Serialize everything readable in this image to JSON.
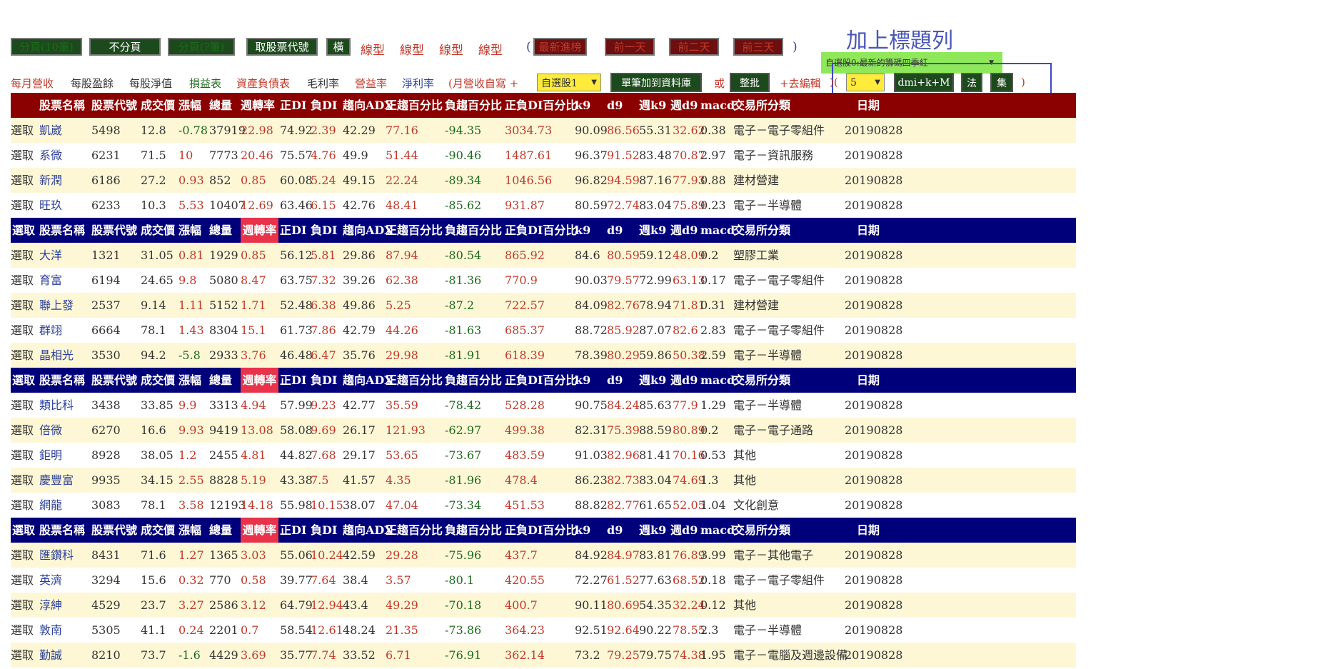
{
  "annotation": {
    "title": "加上標題列",
    "dropdown": "自選股0:最新的籌碼四季紅"
  },
  "top_buttons": [
    "分頁(10筆)",
    "不分頁",
    "分頁(?筆)",
    "取股票代號",
    "橫"
  ],
  "line_types": [
    "線型",
    "線型",
    "線型",
    "線型"
  ],
  "date_buttons": [
    "最新進榜",
    "前一天",
    "前二天",
    "前三天"
  ],
  "parens": {
    "open": "(",
    "close": ")"
  },
  "links": [
    "每月營收",
    "每股盈餘",
    "每股淨值",
    "損益表",
    "資產負債表",
    "毛利率",
    "營益率",
    "淨利率"
  ],
  "toolbar": {
    "monthly_custom": "(月營收自寫 +",
    "select_watchlist": "自選股1",
    "add_to_db": "單筆加到資料庫",
    "or": "或",
    "batch": "整批",
    "edit": "+去編輯",
    "paren_open": ")(",
    "count": "5",
    "dmi": "dmi+k+M",
    "fa": "法",
    "ji": "集",
    "close": ")"
  },
  "header": {
    "select": "選取",
    "cols": [
      "股票名稱",
      "股票代號",
      "成交價",
      "漲幅",
      "總量",
      "週轉率",
      "正DI",
      "負DI",
      "趨向ADX",
      "正趨百分比",
      "負趨百分比",
      "正負DI百分比",
      "k9",
      "d9",
      "週k9",
      "週d9",
      "macd",
      "交易所分類",
      "日期"
    ]
  },
  "rows": [
    {
      "type": "header",
      "style": "red"
    },
    {
      "type": "data",
      "v": [
        "選取",
        "凱崴",
        "5498",
        "12.8",
        "-0.78",
        "37919",
        "22.98",
        "74.92",
        "2.39",
        "42.29",
        "77.16",
        "-94.35",
        "3034.73",
        "90.09",
        "86.56",
        "55.31",
        "32.62",
        "0.38",
        "電子－電子零組件",
        "20190828"
      ]
    },
    {
      "type": "data",
      "v": [
        "選取",
        "系微",
        "6231",
        "71.5",
        "10",
        "7773",
        "20.46",
        "75.57",
        "4.76",
        "49.9",
        "51.44",
        "-90.46",
        "1487.61",
        "96.37",
        "91.52",
        "83.48",
        "70.87",
        "2.97",
        "電子－資訊服務",
        "20190828"
      ]
    },
    {
      "type": "data",
      "v": [
        "選取",
        "新潤",
        "6186",
        "27.2",
        "0.93",
        "852",
        "0.85",
        "60.08",
        "5.24",
        "49.15",
        "22.24",
        "-89.34",
        "1046.56",
        "96.82",
        "94.59",
        "87.16",
        "77.93",
        "0.88",
        "建材營建",
        "20190828"
      ]
    },
    {
      "type": "data",
      "v": [
        "選取",
        "旺玖",
        "6233",
        "10.3",
        "5.53",
        "10407",
        "12.69",
        "63.46",
        "6.15",
        "42.76",
        "48.41",
        "-85.62",
        "931.87",
        "80.59",
        "72.74",
        "83.04",
        "75.89",
        "0.23",
        "電子－半導體",
        "20190828"
      ]
    },
    {
      "type": "header",
      "style": "blue"
    },
    {
      "type": "data",
      "v": [
        "選取",
        "大洋",
        "1321",
        "31.05",
        "0.81",
        "1929",
        "0.85",
        "56.12",
        "5.81",
        "29.86",
        "87.94",
        "-80.54",
        "865.92",
        "84.6",
        "80.59",
        "59.12",
        "48.09",
        "0.2",
        "塑膠工業",
        "20190828"
      ]
    },
    {
      "type": "data",
      "v": [
        "選取",
        "育富",
        "6194",
        "24.65",
        "9.8",
        "5080",
        "8.47",
        "63.75",
        "7.32",
        "39.26",
        "62.38",
        "-81.36",
        "770.9",
        "90.03",
        "79.57",
        "72.99",
        "63.13",
        "0.17",
        "電子－電子零組件",
        "20190828"
      ]
    },
    {
      "type": "data",
      "v": [
        "選取",
        "聯上發",
        "2537",
        "9.14",
        "1.11",
        "5152",
        "1.71",
        "52.48",
        "6.38",
        "49.86",
        "5.25",
        "-87.2",
        "722.57",
        "84.09",
        "82.76",
        "78.94",
        "71.81",
        "0.31",
        "建材營建",
        "20190828"
      ]
    },
    {
      "type": "data",
      "v": [
        "選取",
        "群翊",
        "6664",
        "78.1",
        "1.43",
        "8304",
        "15.1",
        "61.73",
        "7.86",
        "42.79",
        "44.26",
        "-81.63",
        "685.37",
        "88.72",
        "85.92",
        "87.07",
        "82.6",
        "2.83",
        "電子－電子零組件",
        "20190828"
      ]
    },
    {
      "type": "data",
      "v": [
        "選取",
        "晶相光",
        "3530",
        "94.2",
        "-5.8",
        "2933",
        "3.76",
        "46.48",
        "6.47",
        "35.76",
        "29.98",
        "-81.91",
        "618.39",
        "78.39",
        "80.29",
        "59.86",
        "50.38",
        "2.59",
        "電子－半導體",
        "20190828"
      ]
    },
    {
      "type": "header",
      "style": "blue"
    },
    {
      "type": "data",
      "v": [
        "選取",
        "類比科",
        "3438",
        "33.85",
        "9.9",
        "3313",
        "4.94",
        "57.99",
        "9.23",
        "42.77",
        "35.59",
        "-78.42",
        "528.28",
        "90.75",
        "84.24",
        "85.63",
        "77.9",
        "1.29",
        "電子－半導體",
        "20190828"
      ]
    },
    {
      "type": "data",
      "v": [
        "選取",
        "倍微",
        "6270",
        "16.6",
        "9.93",
        "9419",
        "13.08",
        "58.08",
        "9.69",
        "26.17",
        "121.93",
        "-62.97",
        "499.38",
        "82.31",
        "75.39",
        "88.59",
        "80.89",
        "0.2",
        "電子－電子通路",
        "20190828"
      ]
    },
    {
      "type": "data",
      "v": [
        "選取",
        "鉅明",
        "8928",
        "38.05",
        "1.2",
        "2455",
        "4.81",
        "44.82",
        "7.68",
        "29.17",
        "53.65",
        "-73.67",
        "483.59",
        "91.03",
        "82.96",
        "81.41",
        "70.16",
        "0.53",
        "其他",
        "20190828"
      ]
    },
    {
      "type": "data",
      "v": [
        "選取",
        "慶豐富",
        "9935",
        "34.15",
        "2.55",
        "8828",
        "5.19",
        "43.38",
        "7.5",
        "41.57",
        "4.35",
        "-81.96",
        "478.4",
        "86.23",
        "82.73",
        "83.04",
        "74.69",
        "1.3",
        "其他",
        "20190828"
      ]
    },
    {
      "type": "data",
      "v": [
        "選取",
        "網龍",
        "3083",
        "78.1",
        "3.58",
        "12193",
        "14.18",
        "55.98",
        "10.15",
        "38.07",
        "47.04",
        "-73.34",
        "451.53",
        "88.82",
        "82.77",
        "61.65",
        "52.05",
        "1.04",
        "文化創意",
        "20190828"
      ]
    },
    {
      "type": "header",
      "style": "blue"
    },
    {
      "type": "data",
      "v": [
        "選取",
        "匯鑽科",
        "8431",
        "71.6",
        "1.27",
        "1365",
        "3.03",
        "55.06",
        "10.24",
        "42.59",
        "29.28",
        "-75.96",
        "437.7",
        "84.92",
        "84.97",
        "83.81",
        "76.89",
        "3.99",
        "電子－其他電子",
        "20190828"
      ]
    },
    {
      "type": "data",
      "v": [
        "選取",
        "英濟",
        "3294",
        "15.6",
        "0.32",
        "770",
        "0.58",
        "39.77",
        "7.64",
        "38.4",
        "3.57",
        "-80.1",
        "420.55",
        "72.27",
        "61.52",
        "77.63",
        "68.52",
        "0.18",
        "電子－電子零組件",
        "20190828"
      ]
    },
    {
      "type": "data",
      "v": [
        "選取",
        "淳紳",
        "4529",
        "23.7",
        "3.27",
        "2586",
        "3.12",
        "64.79",
        "12.94",
        "43.4",
        "49.29",
        "-70.18",
        "400.7",
        "90.11",
        "80.69",
        "54.35",
        "32.24",
        "0.12",
        "其他",
        "20190828"
      ]
    },
    {
      "type": "data",
      "v": [
        "選取",
        "敦南",
        "5305",
        "41.1",
        "0.24",
        "2201",
        "0.7",
        "58.54",
        "12.61",
        "48.24",
        "21.35",
        "-73.86",
        "364.23",
        "92.51",
        "92.64",
        "90.22",
        "78.55",
        "2.3",
        "電子－半導體",
        "20190828"
      ]
    },
    {
      "type": "data",
      "v": [
        "選取",
        "勤誠",
        "8210",
        "73.7",
        "-1.6",
        "4429",
        "3.69",
        "35.77",
        "7.74",
        "33.52",
        "6.71",
        "-76.91",
        "362.14",
        "73.2",
        "79.25",
        "79.75",
        "74.38",
        "1.95",
        "電子－電腦及週邊設備",
        "20190828"
      ]
    }
  ]
}
